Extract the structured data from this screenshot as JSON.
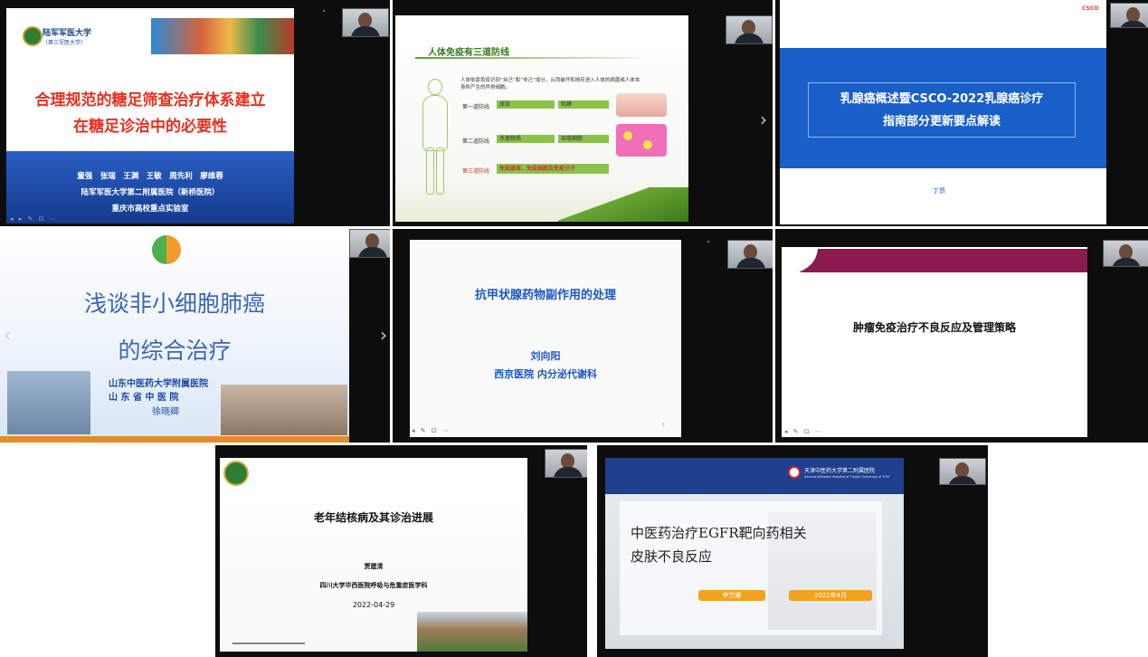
{
  "tile1": {
    "logo_line1": "陆军军医大学",
    "logo_line2": "（第三军医大学）",
    "title_line1": "合理规范的糖足筛查治疗体系建立",
    "title_line2": "在糖足诊治中的必要性",
    "authors": "童强　张瑞　王渊　王敏　周先利　廖维蓉",
    "affiliation1": "陆军军医大学第二附属医院（新桥医院）",
    "affiliation2": "重庆市高校重点实验室"
  },
  "tile2": {
    "title": "人体免疫有三道防线",
    "intro_line1": "人体依靠免疫识别“自己”和“非己”成分，从而破坏和排斥进入人体的病菌或人体本",
    "intro_line2": "身所产生的异常细胞。",
    "line1_label": "第一道防线",
    "line1_a": "皮肤",
    "line1_b": "粘膜",
    "line2_label": "第二道防线",
    "line2_a": "杀菌物质",
    "line2_b": "吞噬细胞",
    "line3_label": "第三道防线",
    "line3_text": "免疫器官、免疫细胞及免疫分子"
  },
  "tile3": {
    "corner_logo": "CSCO",
    "title_line1": "乳腺癌概述暨CSCO-2022乳腺癌诊疗",
    "title_line2": "指南部分更新要点解读",
    "speaker": "丁昂"
  },
  "tile4": {
    "title_line1": "浅谈非小细胞肺癌",
    "title_line2": "的综合治疗",
    "hospital1": "山东中医药大学附属医院",
    "hospital2": "山 东 省 中 医 院",
    "speaker": "徐晓卿"
  },
  "tile5": {
    "title": "抗甲状腺药物副作用的处理",
    "speaker": "刘向阳",
    "department": "西京医院 内分泌代谢科",
    "page": "1"
  },
  "tile6": {
    "title": "肿瘤免疫治疗不良反应及管理策略"
  },
  "tile7": {
    "title": "老年结核病及其诊治进展",
    "speaker": "贾建清",
    "department": "四川大学华西医院呼吸与危重症医学科",
    "date": "2022-04-29"
  },
  "tile8": {
    "hospital_cn": "天津中医药大学第二附属医院",
    "hospital_en": "Second Affiliated Hospital of Tianjin University of TCM",
    "title_line1": "中医药治疗EGFR靶向药相关",
    "title_line2": "皮肤不良反应",
    "speaker": "李竹娜",
    "date": "2022年4月"
  },
  "colors": {
    "tile1_title_red": "#e8301f",
    "tile1_band_blue": "#1f4fb3",
    "tile3_blue": "#1a5fc8",
    "tile5_blue": "#1a56c4",
    "tile6_maroon": "#8c1a4e",
    "tile8_orange": "#f2a21e"
  }
}
